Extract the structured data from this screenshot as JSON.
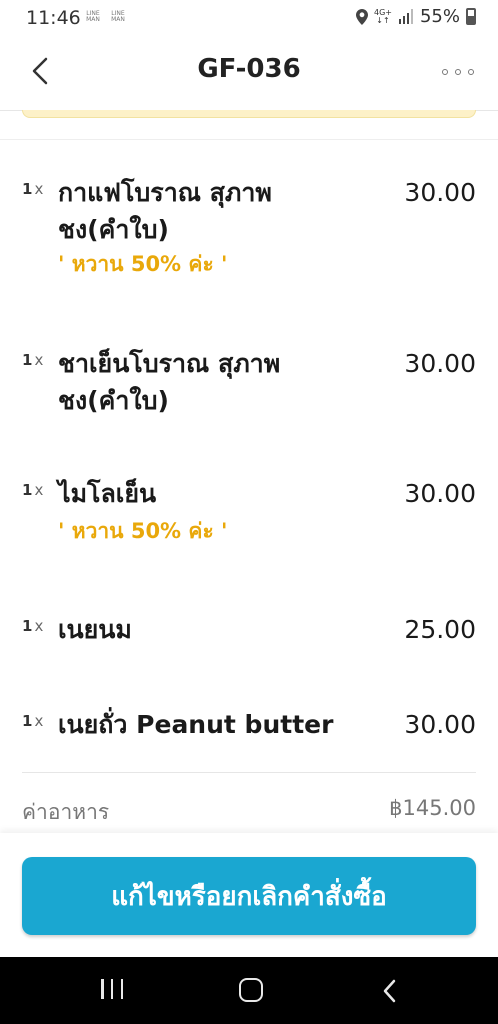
{
  "status_bar": {
    "time": "11:46",
    "mini_icons": [
      "LINE MAN",
      "LINE MAN"
    ],
    "network": "4G+",
    "battery": "55%",
    "battery_level": 0.55
  },
  "header": {
    "title": "GF-036"
  },
  "items": [
    {
      "qty": "1",
      "x": "x",
      "name_lines": [
        "กาแฟโบราณ สุภาพ",
        "ชง(คำใบ)"
      ],
      "note": "' หวาน 50% ค่ะ '",
      "price": "30.00"
    },
    {
      "qty": "1",
      "x": "x",
      "name_lines": [
        "ชาเย็นโบราณ สุภาพ",
        "ชง(คำใบ)"
      ],
      "note": "",
      "price": "30.00"
    },
    {
      "qty": "1",
      "x": "x",
      "name_lines": [
        "ไมโลเย็น"
      ],
      "note": "' หวาน 50% ค่ะ '",
      "price": "30.00"
    },
    {
      "qty": "1",
      "x": "x",
      "name_lines": [
        "เนยนม"
      ],
      "note": "",
      "price": "25.00"
    },
    {
      "qty": "1",
      "x": "x",
      "name_lines": [
        "เนยถั่ว Peanut butter"
      ],
      "note": "",
      "price": "30.00"
    }
  ],
  "summary": {
    "food_label": "ค่าอาหาร",
    "food_value": "฿145.00"
  },
  "actions": {
    "edit_cancel_label": "แก้ไขหรือยกเลิกคำสั่งซื้อ"
  },
  "colors": {
    "accent": "#1aa7d1",
    "note": "#e9a80a"
  }
}
